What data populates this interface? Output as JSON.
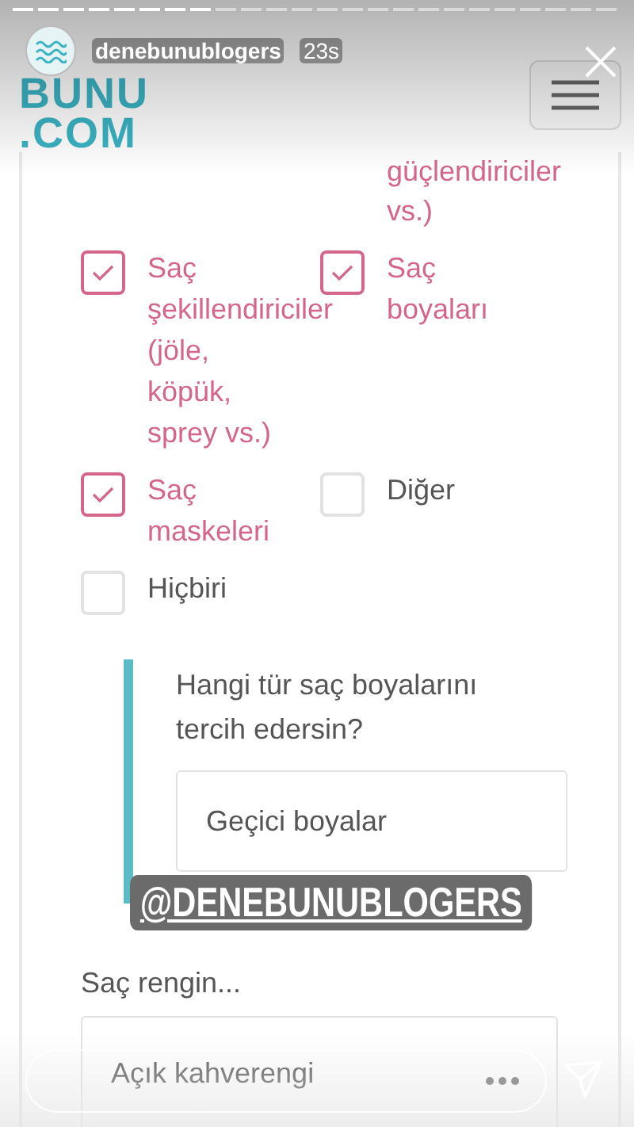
{
  "story": {
    "username": "denebunublogers",
    "time": "23s"
  },
  "site": {
    "logo": [
      "BUNU",
      ".COM"
    ]
  },
  "question_tail": [
    "güçlendiriciler",
    "vs.)"
  ],
  "options": [
    {
      "label": "Saç şekillendiriciler (jöle, köpük, sprey vs.)",
      "checked": true
    },
    {
      "label": "Saç boyaları",
      "checked": true
    },
    {
      "label": "Saç maskeleri",
      "checked": true
    },
    {
      "label": "Diğer",
      "checked": false
    },
    {
      "label": "Hiçbiri",
      "checked": false
    }
  ],
  "subquestion": {
    "text": "Hangi tür saç boyalarını tercih edersin?",
    "value": "Geçici boyalar"
  },
  "mention": "@DENEBUNUBLOGERS",
  "hair_color": {
    "label": "Saç rengin...",
    "value": "Açık kahverengi"
  }
}
